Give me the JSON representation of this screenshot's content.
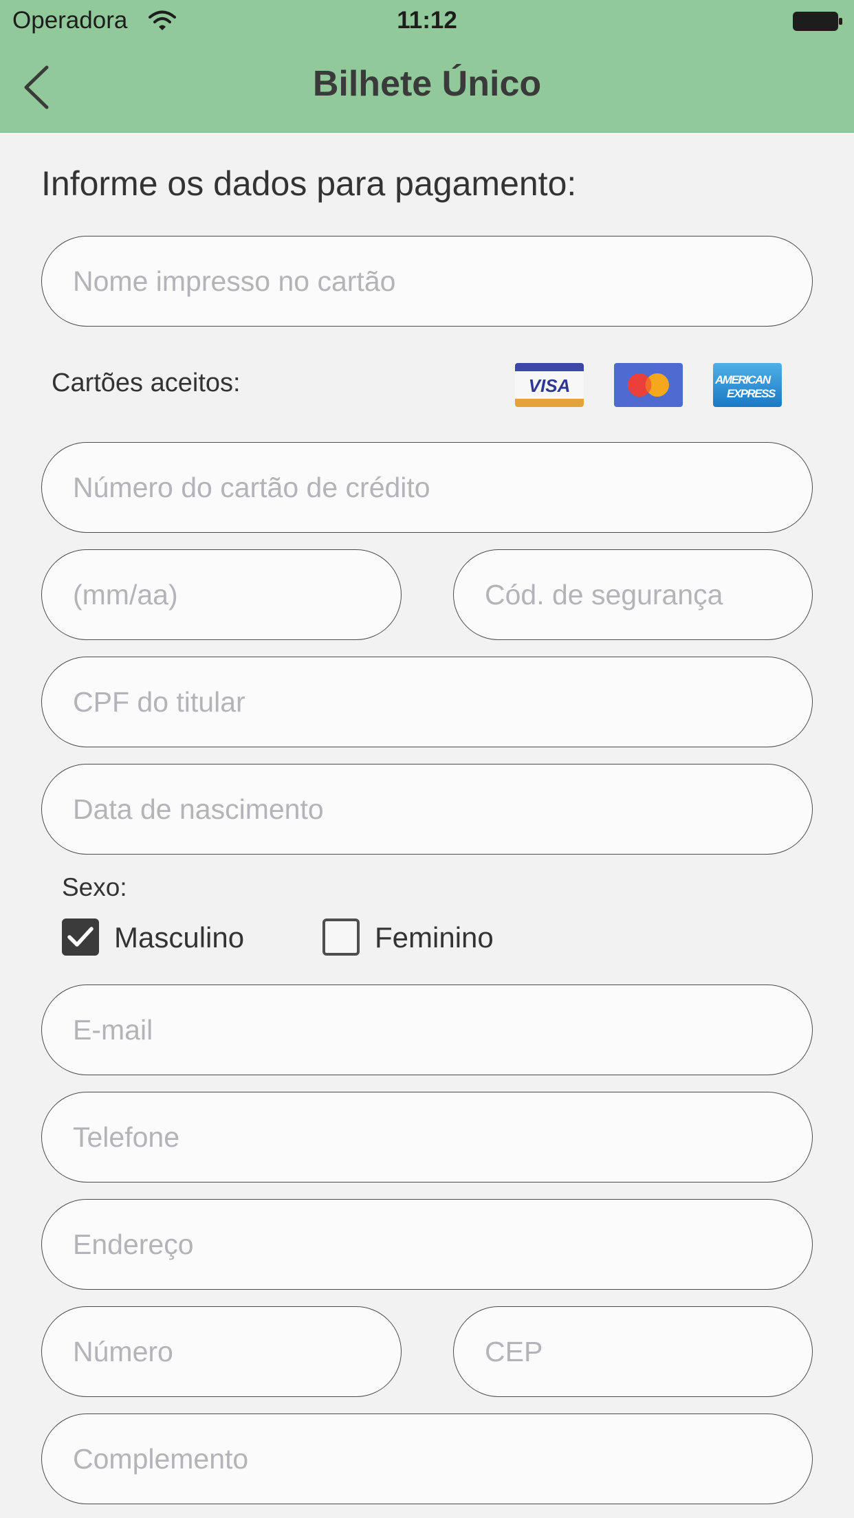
{
  "status_bar": {
    "carrier": "Operadora",
    "time": "11:12"
  },
  "nav": {
    "title": "Bilhete Único",
    "back_icon": "chevron-left-icon"
  },
  "form": {
    "heading": "Informe os dados para pagamento:",
    "name_placeholder": "Nome impresso no cartão",
    "accepted_cards_label": "Cartões aceitos:",
    "accepted_cards": [
      "visa",
      "mastercard",
      "american-express"
    ],
    "card_number_placeholder": "Número do cartão de crédito",
    "expiry_placeholder": "(mm/aa)",
    "cvv_placeholder": "Cód. de segurança",
    "cpf_placeholder": "CPF do titular",
    "birthdate_placeholder": "Data de nascimento",
    "sex_label": "Sexo:",
    "sex_options": [
      {
        "label": "Masculino",
        "checked": true
      },
      {
        "label": "Feminino",
        "checked": false
      }
    ],
    "email_placeholder": "E-mail",
    "phone_placeholder": "Telefone",
    "address_placeholder": "Endereço",
    "number_placeholder": "Número",
    "cep_placeholder": "CEP",
    "complement_placeholder": "Complemento"
  },
  "colors": {
    "header": "#92c99a",
    "background": "#f2f2f2",
    "checkbox": "#3b3b3b"
  }
}
